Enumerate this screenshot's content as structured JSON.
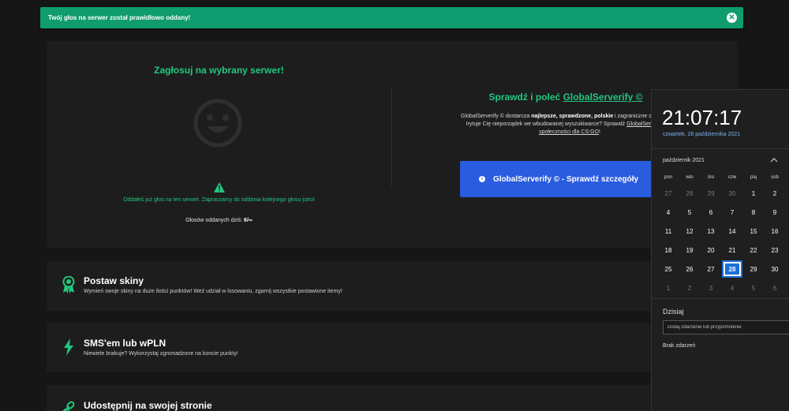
{
  "toast": {
    "message": "Twój głos na serwer został prawidłowo oddany!",
    "close_glyph": "✕"
  },
  "vote": {
    "title": "Zagłosuj na wybrany serwer!",
    "voted_message": "Oddałeś już głos na ten serwer. Zapraszamy do oddania kolejnego głosu jutro!",
    "votes_today_label": "Głosów oddanych dziś:",
    "votes_today_value": "6/∞"
  },
  "promo": {
    "title_prefix": "Sprawdź i poleć ",
    "title_link": "GlobalServerify ©",
    "desc_line1_a": "GlobalServerify © dostarcza ",
    "desc_line1_bold": "najlepsze, sprawdzone, polskie",
    "desc_line1_b": " i zagraniczne serwery bez",
    "desc_line2_a": "Irytuje Cię nieporządek we wbudowanej wyszukiwarce? Sprawdź ",
    "desc_line2_link": "GlobalServerify © -",
    "desc_line3_link": "społeczności dla CS:GO",
    "desc_line3_end": "!",
    "button_label": "GlobalServerify © - Sprawdź szczegóły",
    "button_icon": "i"
  },
  "features": [
    {
      "title": "Postaw skiny",
      "subtitle": "Wymień swoje skiny na duże ilości punktów! Weź udział w losowaniu, zgarnij wszystkie postawione itemy!"
    },
    {
      "title": "SMS'em lub wPLN",
      "subtitle": "Niewiele brakuje? Wykorzystaj zgromadzone na koncie punkty!"
    },
    {
      "title": "Udostępnij na swojej stronie",
      "subtitle": ""
    }
  ],
  "clock": {
    "time": "21:07:17",
    "date": "czwartek, 28 października 2021",
    "month": "październik 2021",
    "weekdays": [
      "pon",
      "wto",
      "śro",
      "czw",
      "pią",
      "sob"
    ],
    "weeks": [
      [
        "27",
        "28",
        "29",
        "30",
        "1",
        "2"
      ],
      [
        "4",
        "5",
        "6",
        "7",
        "8",
        "9"
      ],
      [
        "11",
        "12",
        "13",
        "14",
        "15",
        "16"
      ],
      [
        "18",
        "19",
        "20",
        "21",
        "22",
        "23"
      ],
      [
        "25",
        "26",
        "27",
        "28",
        "29",
        "30"
      ],
      [
        "1",
        "2",
        "3",
        "4",
        "5",
        "6"
      ]
    ],
    "today": "28",
    "today_label": "Dzisiaj",
    "event_placeholder": "Dodaj zdarzenie lub przypomnienie",
    "no_events": "Brak zdarzeń"
  },
  "colors": {
    "accent_green": "#22c77f",
    "toast_green": "#0f9c6e",
    "button_blue": "#2a5ce0",
    "today_blue": "#1a6fd6"
  }
}
